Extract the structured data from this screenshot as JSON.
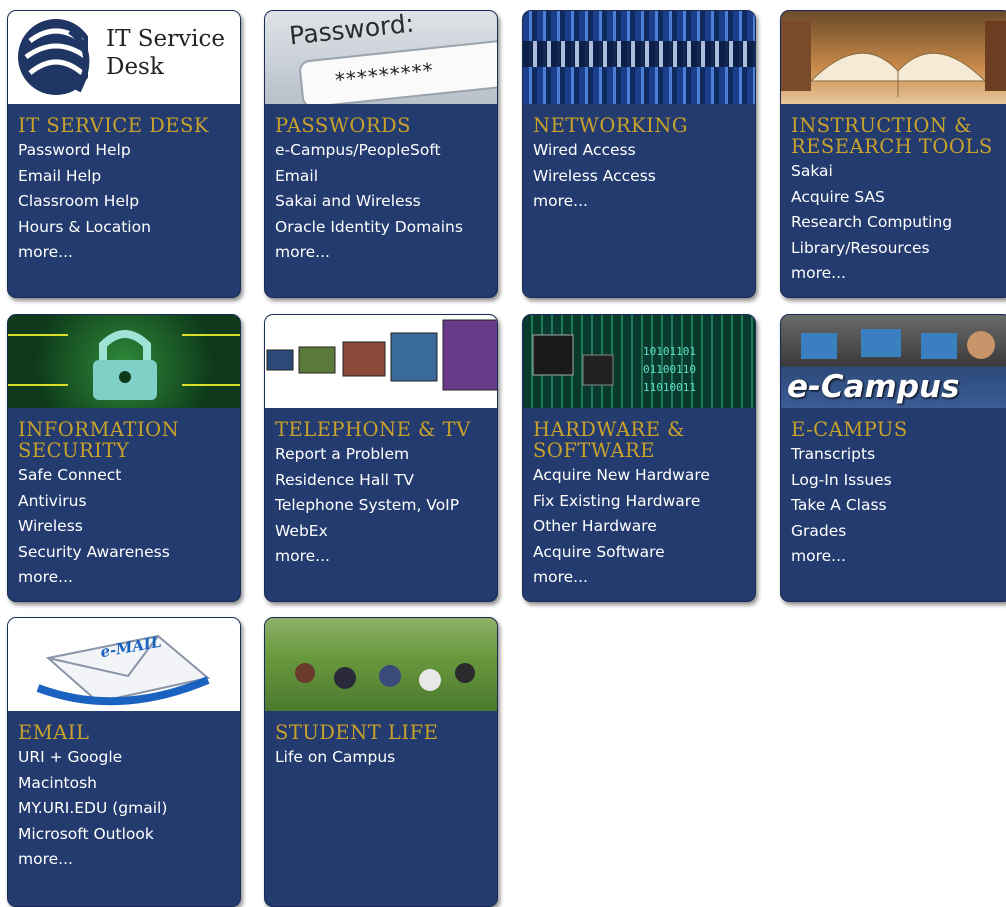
{
  "cards": [
    {
      "title": "IT SERVICE DESK",
      "image_label": "IT Service Desk",
      "items": [
        "Password Help",
        "Email Help",
        "Classroom Help",
        "Hours & Location",
        "more..."
      ]
    },
    {
      "title": "PASSWORDS",
      "image_label": "Password:",
      "image_stars": "*********",
      "items": [
        "e-Campus/PeopleSoft",
        "Email",
        "Sakai and Wireless",
        "Oracle Identity Domains",
        "more..."
      ]
    },
    {
      "title": "NETWORKING",
      "items": [
        "Wired Access",
        "Wireless Access",
        "more..."
      ]
    },
    {
      "title": "INSTRUCTION & RESEARCH TOOLS",
      "items": [
        "Sakai",
        "Acquire SAS",
        "Research Computing",
        "Library/Resources",
        "more..."
      ]
    },
    {
      "title": "INFORMATION SECURITY",
      "items": [
        "Safe Connect",
        "Antivirus",
        "Wireless",
        "Security Awareness",
        "more..."
      ]
    },
    {
      "title": "TELEPHONE & TV",
      "items": [
        "Report a Problem",
        "Residence Hall TV",
        "Telephone System,  VoIP",
        "WebEx",
        "more..."
      ]
    },
    {
      "title": "HARDWARE & SOFTWARE",
      "items": [
        "Acquire New Hardware",
        "Fix Existing Hardware",
        "Other Hardware",
        "Acquire Software",
        "more..."
      ]
    },
    {
      "title": "E-CAMPUS",
      "image_label": "e-Campus",
      "items": [
        "Transcripts",
        "Log-In Issues",
        "Take A Class",
        "Grades",
        "more..."
      ]
    },
    {
      "title": "EMAIL",
      "image_label": "e-MAIL",
      "items": [
        "URI + Google",
        "Macintosh",
        "MY.URI.EDU (gmail)",
        "Microsoft Outlook",
        "more..."
      ]
    },
    {
      "title": "STUDENT LIFE",
      "items": [
        "Life on Campus"
      ]
    }
  ],
  "colors": {
    "card_bg": "#233b6e",
    "title_gold": "#c9a22b",
    "link_white": "#ffffff"
  }
}
